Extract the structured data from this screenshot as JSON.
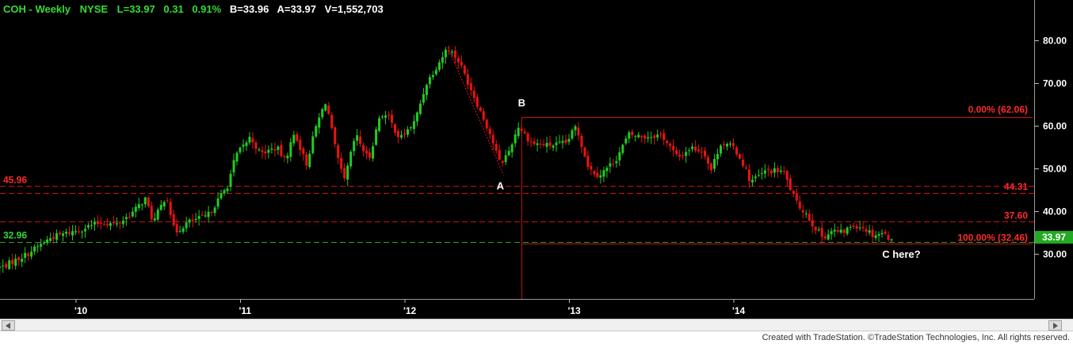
{
  "header": {
    "symbol_title": "COH - Weekly",
    "exchange": "NYSE",
    "last": "L=33.97",
    "change": "0.31",
    "change_pct": "0.91%",
    "bid": "B=33.96",
    "ask": "A=33.97",
    "volume": "V=1,552,703"
  },
  "footer": {
    "credit": "Created with TradeStation. ©TradeStation Technologies, Inc. All rights reserved."
  },
  "colors": {
    "background": "#000000",
    "up": "#22cc22",
    "down": "#ee1111",
    "level_line": "#cc1111",
    "support_line": "#22aa22",
    "label_red": "#ff2a2a",
    "label_green": "#33dd33"
  },
  "chart_data": {
    "type": "candlestick",
    "interval": "weekly",
    "ylim": [
      23,
      84
    ],
    "yticks": [
      30,
      40,
      50,
      60,
      70,
      80
    ],
    "ytick_labels": [
      "30.00",
      "40.00",
      "50.00",
      "60.00",
      "70.00",
      "80.00"
    ],
    "xticks": [
      {
        "label": "'10",
        "t": 2010
      },
      {
        "label": "'11",
        "t": 2011
      },
      {
        "label": "'12",
        "t": 2012
      },
      {
        "label": "'13",
        "t": 2013
      },
      {
        "label": "'14",
        "t": 2014
      }
    ],
    "last_price": {
      "label": "33.97",
      "value": 33.97
    },
    "series": [
      {
        "anchors": [
          [
            2009.55,
            27.0
          ],
          [
            2009.7,
            30.0
          ],
          [
            2009.85,
            34.0
          ],
          [
            2010.0,
            35.5
          ],
          [
            2010.15,
            37.5
          ],
          [
            2010.25,
            37.0
          ],
          [
            2010.35,
            40.0
          ],
          [
            2010.42,
            43.0
          ],
          [
            2010.47,
            37.5
          ],
          [
            2010.55,
            44.0
          ],
          [
            2010.6,
            35.0
          ],
          [
            2010.68,
            37.5
          ],
          [
            2010.8,
            39.0
          ],
          [
            2010.92,
            46.0
          ],
          [
            2010.97,
            53.0
          ],
          [
            2011.06,
            57.5
          ],
          [
            2011.12,
            53.5
          ],
          [
            2011.22,
            55.0
          ],
          [
            2011.27,
            52.0
          ],
          [
            2011.33,
            58.5
          ],
          [
            2011.4,
            51.0
          ],
          [
            2011.46,
            60.0
          ],
          [
            2011.52,
            66.0
          ],
          [
            2011.58,
            54.0
          ],
          [
            2011.63,
            47.0
          ],
          [
            2011.7,
            58.0
          ],
          [
            2011.78,
            52.0
          ],
          [
            2011.85,
            63.0
          ],
          [
            2011.9,
            62.0
          ],
          [
            2011.97,
            57.0
          ],
          [
            2012.06,
            61.0
          ],
          [
            2012.13,
            70.0
          ],
          [
            2012.2,
            74.5
          ],
          [
            2012.26,
            78.5
          ],
          [
            2012.33,
            75.0
          ],
          [
            2012.42,
            67.0
          ],
          [
            2012.52,
            58.0
          ],
          [
            2012.58,
            51.0
          ],
          [
            2012.63,
            54.0
          ],
          [
            2012.69,
            60.0
          ],
          [
            2012.77,
            56.0
          ],
          [
            2012.88,
            55.5
          ],
          [
            2012.98,
            56.0
          ],
          [
            2013.04,
            60.0
          ],
          [
            2013.12,
            50.0
          ],
          [
            2013.18,
            48.5
          ],
          [
            2013.28,
            52.0
          ],
          [
            2013.36,
            58.0
          ],
          [
            2013.46,
            57.5
          ],
          [
            2013.56,
            58.0
          ],
          [
            2013.66,
            52.5
          ],
          [
            2013.74,
            55.0
          ],
          [
            2013.82,
            54.0
          ],
          [
            2013.86,
            49.5
          ],
          [
            2013.92,
            56.0
          ],
          [
            2014.0,
            55.0
          ],
          [
            2014.06,
            51.0
          ],
          [
            2014.1,
            47.0
          ],
          [
            2014.2,
            49.5
          ],
          [
            2014.3,
            49.5
          ],
          [
            2014.38,
            42.0
          ],
          [
            2014.44,
            39.5
          ],
          [
            2014.48,
            37.0
          ],
          [
            2014.54,
            34.0
          ],
          [
            2014.6,
            35.5
          ],
          [
            2014.66,
            35.0
          ],
          [
            2014.72,
            36.8
          ],
          [
            2014.78,
            36.5
          ],
          [
            2014.85,
            34.5
          ],
          [
            2014.9,
            35.0
          ],
          [
            2014.94,
            34.0
          ]
        ]
      }
    ],
    "levels": [
      {
        "value": 45.96,
        "style": "dashed",
        "color": "#cc1111"
      },
      {
        "value": 44.31,
        "style": "dashed",
        "color": "#cc1111"
      },
      {
        "value": 37.6,
        "style": "dashed",
        "color": "#cc1111"
      },
      {
        "value": 32.96,
        "style": "dashed",
        "color": "#22aa22"
      }
    ],
    "level_labels": [
      {
        "text": "45.96",
        "value": 45.96,
        "side": "left",
        "color": "#ff2a2a"
      },
      {
        "text": "32.96",
        "value": 32.96,
        "side": "left",
        "color": "#33dd33"
      },
      {
        "text": "44.31",
        "value": 44.31,
        "side": "right",
        "color": "#ff2a2a"
      },
      {
        "text": "37.60",
        "value": 37.6,
        "side": "right",
        "color": "#ff2a2a"
      }
    ],
    "fibonacci": {
      "t_start": 2012.71,
      "t_end": 2014.97,
      "top_value": 62.06,
      "bottom_value": 32.46,
      "top_label": "0.00% (62.06)",
      "bottom_label": "100.00% (32.46)"
    },
    "trend_line": {
      "from": [
        2012.26,
        78.5
      ],
      "to": [
        2012.6,
        48.5
      ]
    },
    "wave_labels": [
      {
        "text": "A",
        "t": 2012.58,
        "value": 48.5,
        "placement": "below"
      },
      {
        "text": "B",
        "t": 2012.71,
        "value": 62.06,
        "placement": "above"
      },
      {
        "text": "C here?",
        "t": 2014.96,
        "value": 32.46,
        "placement": "below"
      }
    ]
  }
}
